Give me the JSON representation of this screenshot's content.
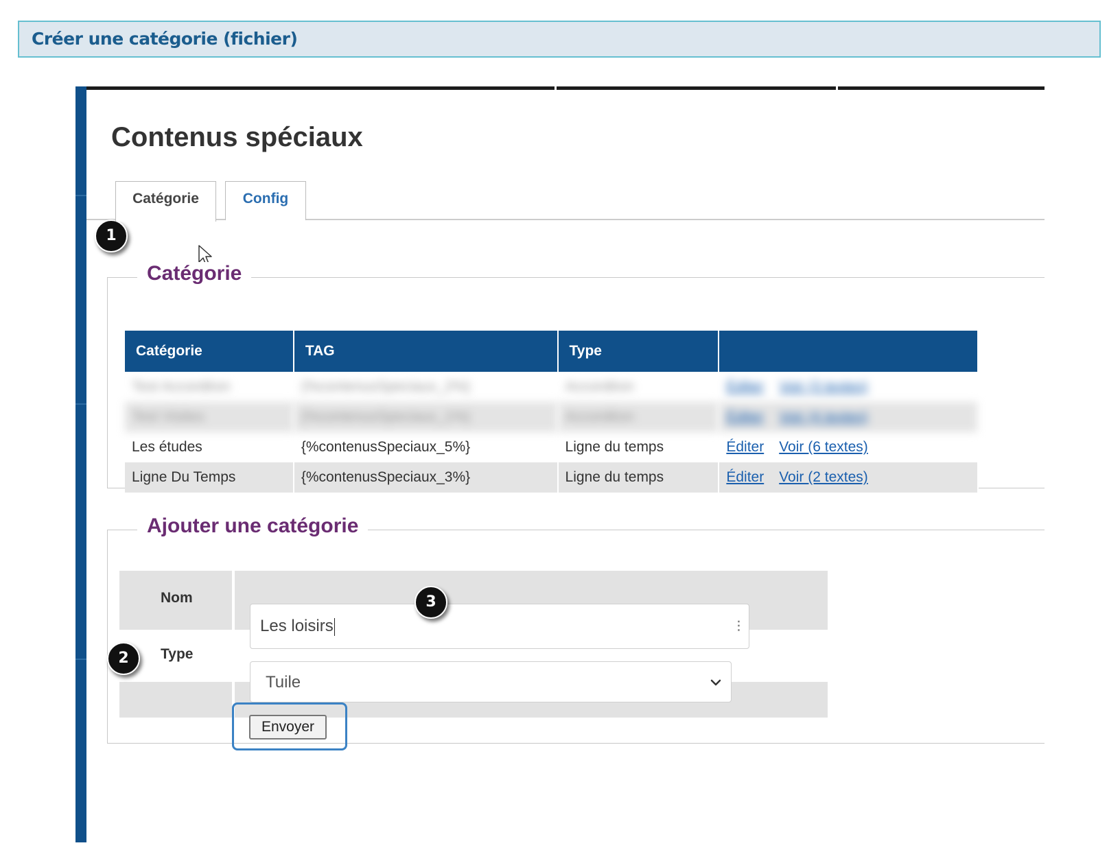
{
  "banner": {
    "title": "Créer une catégorie (fichier)"
  },
  "page": {
    "title": "Contenus spéciaux"
  },
  "tabs": [
    {
      "label": "Catégorie",
      "active": true
    },
    {
      "label": "Config",
      "active": false
    }
  ],
  "badges": [
    "1",
    "2",
    "3"
  ],
  "category_section": {
    "legend": "Catégorie",
    "table": {
      "headers": [
        "Catégorie",
        "TAG",
        "Type",
        ""
      ],
      "rows": [
        {
          "name": "Test Accordéon",
          "tag": "{%contenusSpeciaux_2%}",
          "type": "Accordéon",
          "edit": "Éditer",
          "view": "Voir (3 textes)"
        },
        {
          "name": "Test Visites",
          "tag": "{%contenusSpeciaux_1%}",
          "type": "Accordéon",
          "edit": "Éditer",
          "view": "Voir (4 textes)"
        },
        {
          "name": "Les études",
          "tag": "{%contenusSpeciaux_5%}",
          "type": "Ligne du temps",
          "edit": "Éditer",
          "view": "Voir (6 textes)"
        },
        {
          "name": "Ligne Du Temps",
          "tag": "{%contenusSpeciaux_3%}",
          "type": "Ligne du temps",
          "edit": "Éditer",
          "view": "Voir (2 textes)"
        }
      ]
    }
  },
  "add_section": {
    "legend": "Ajouter une catégorie",
    "name_label": "Nom",
    "name_value": "Les loisirs",
    "type_label": "Type",
    "type_value": "Tuile",
    "submit_label": "Envoyer"
  },
  "colors": {
    "header_blue": "#10508a",
    "legend_purple": "#6a2c72",
    "link_blue": "#1a5fae",
    "banner_bg": "#dde7ef"
  }
}
